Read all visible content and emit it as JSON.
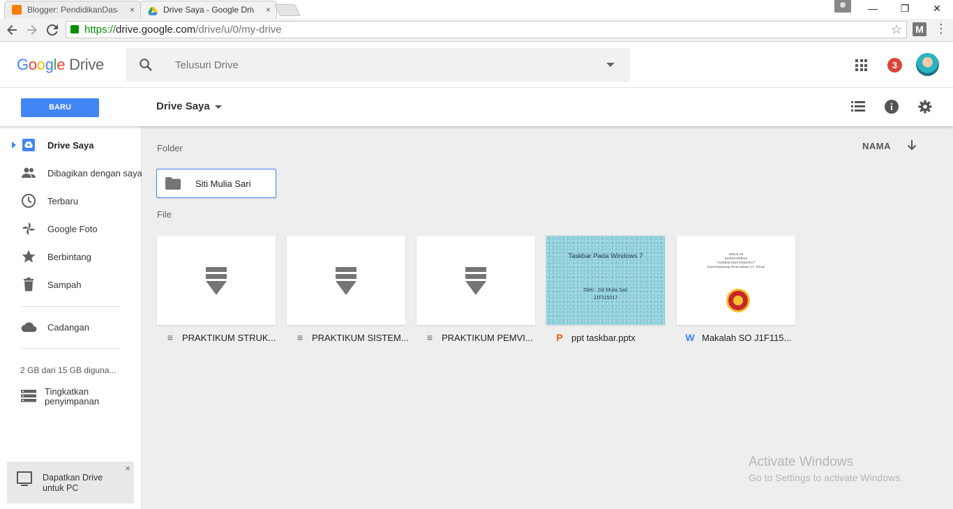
{
  "browser": {
    "tabs": [
      {
        "title": "Blogger: PendidikanDasar",
        "close": "×",
        "favicon_color": "#f57d00",
        "icon": "blogger-icon"
      },
      {
        "title": "Drive Saya - Google Drive",
        "close": "×",
        "favicon_color": "#fbbc05",
        "icon": "drive-icon"
      }
    ],
    "window_controls": {
      "minimize": "—",
      "restore": "❐",
      "close": "✕"
    },
    "url_scheme": "https://",
    "url_host": "drive.google.com",
    "url_path": "/drive/u/0/my-drive",
    "extension_label": "M"
  },
  "header": {
    "logo_letters": [
      "G",
      "o",
      "o",
      "g",
      "l",
      "e"
    ],
    "product": "Drive",
    "search_placeholder": "Telusuri Drive",
    "notification_count": "3"
  },
  "toolbar": {
    "new_button": "BARU",
    "breadcrumb": "Drive Saya"
  },
  "sidebar": {
    "items": [
      {
        "label": "Drive Saya",
        "icon": "my-drive-icon"
      },
      {
        "label": "Dibagikan dengan saya",
        "icon": "shared-icon"
      },
      {
        "label": "Terbaru",
        "icon": "clock-icon"
      },
      {
        "label": "Google Foto",
        "icon": "pinwheel-icon"
      },
      {
        "label": "Berbintang",
        "icon": "star-icon"
      },
      {
        "label": "Sampah",
        "icon": "trash-icon"
      },
      {
        "label": "Cadangan",
        "icon": "cloud-icon"
      }
    ],
    "storage": "2 GB dari 15 GB diguna...",
    "upgrade_line1": "Tingkatkan",
    "upgrade_line2": "penyimpanan",
    "promo_line1": "Dapatkan Drive",
    "promo_line2": "untuk PC",
    "promo_close": "×"
  },
  "main": {
    "folder_section": "Folder",
    "file_section": "File",
    "sort_label": "NAMA",
    "folders": [
      {
        "name": "Siti Mulia Sari"
      }
    ],
    "files": [
      {
        "name": "PRAKTIKUM STRUK...",
        "type": "generic",
        "type_glyph": "≡"
      },
      {
        "name": "PRAKTIKUM SISTEM...",
        "type": "generic",
        "type_glyph": "≡"
      },
      {
        "name": "PRAKTIKUM PEMVI...",
        "type": "generic",
        "type_glyph": "≡"
      },
      {
        "name": "ppt taskbar.pptx",
        "type": "powerpoint",
        "type_glyph": "P",
        "type_color": "#f4511e"
      },
      {
        "name": "Makalah SO J1F115...",
        "type": "word",
        "type_glyph": "W",
        "type_color": "#4285f4"
      }
    ],
    "ppt_preview": {
      "title": "Taskbar Pada Windows 7",
      "byline": "Oleh : Siti Mulia Sari",
      "id": "J1F115017"
    },
    "doc_preview": {
      "lines": [
        "MAKALAH",
        "SISTEM OPERASI",
        "\"TASKBAR PADA WINDOWS 7\"",
        "Dosen Pembimbing: Fitriani Indriani, S.T., M.Kom"
      ]
    }
  },
  "watermark": {
    "line1": "Activate Windows",
    "line2": "Go to Settings to activate Windows."
  }
}
